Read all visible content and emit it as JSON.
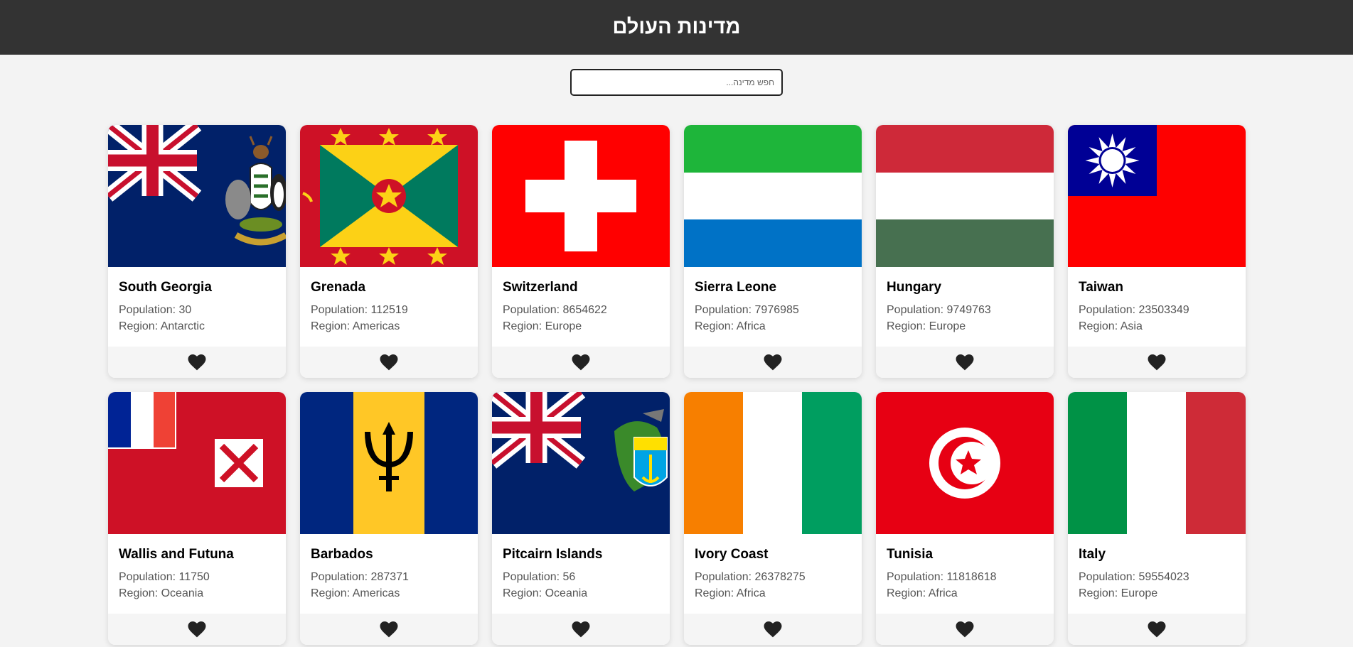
{
  "header": {
    "title": "מדינות העולם"
  },
  "search": {
    "placeholder": "חפש מדינה...",
    "value": ""
  },
  "labels": {
    "population": "Population: ",
    "region": "Region: "
  },
  "icons": {
    "favorite": "heart-icon"
  },
  "colors": {
    "header_bg": "#333333",
    "page_bg": "#f3f3f3",
    "heart": "#222222"
  },
  "countries": [
    {
      "name": "South Georgia",
      "population": "30",
      "region": "Antarctic",
      "flag": "south-georgia"
    },
    {
      "name": "Grenada",
      "population": "112519",
      "region": "Americas",
      "flag": "grenada"
    },
    {
      "name": "Switzerland",
      "population": "8654622",
      "region": "Europe",
      "flag": "switzerland"
    },
    {
      "name": "Sierra Leone",
      "population": "7976985",
      "region": "Africa",
      "flag": "sierra-leone"
    },
    {
      "name": "Hungary",
      "population": "9749763",
      "region": "Europe",
      "flag": "hungary"
    },
    {
      "name": "Taiwan",
      "population": "23503349",
      "region": "Asia",
      "flag": "taiwan"
    },
    {
      "name": "Wallis and Futuna",
      "population": "11750",
      "region": "Oceania",
      "flag": "wallis-and-futuna"
    },
    {
      "name": "Barbados",
      "population": "287371",
      "region": "Americas",
      "flag": "barbados"
    },
    {
      "name": "Pitcairn Islands",
      "population": "56",
      "region": "Oceania",
      "flag": "pitcairn-islands"
    },
    {
      "name": "Ivory Coast",
      "population": "26378275",
      "region": "Africa",
      "flag": "ivory-coast"
    },
    {
      "name": "Tunisia",
      "population": "11818618",
      "region": "Africa",
      "flag": "tunisia"
    },
    {
      "name": "Italy",
      "population": "59554023",
      "region": "Europe",
      "flag": "italy"
    }
  ]
}
